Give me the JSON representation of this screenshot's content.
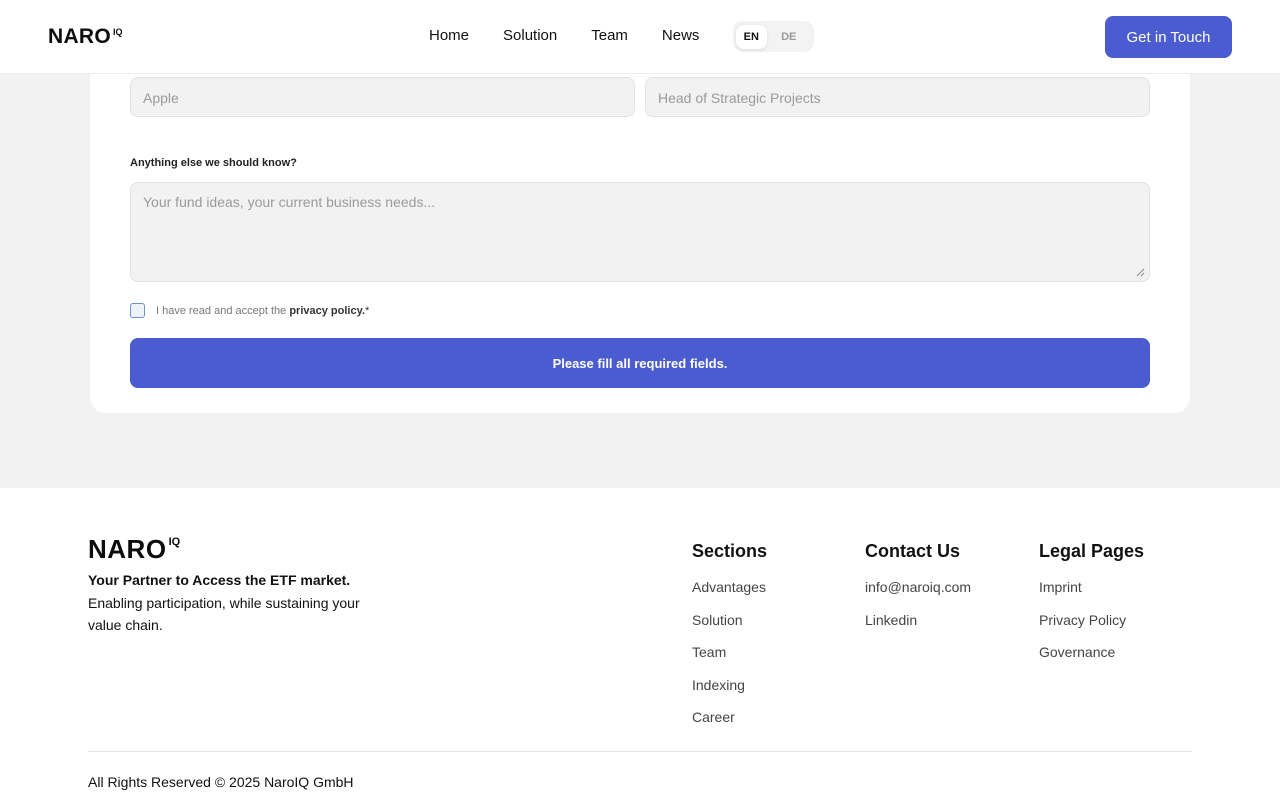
{
  "header": {
    "logo": "NARO",
    "logo_sup": "IQ",
    "nav": [
      "Home",
      "Solution",
      "Team",
      "News"
    ],
    "languages": [
      "EN",
      "DE"
    ],
    "active_language": "EN",
    "cta": "Get in Touch"
  },
  "form": {
    "company_placeholder": "Apple",
    "position_placeholder": "Head of Strategic Projects",
    "message_label": "Anything else we should know?",
    "message_placeholder": "Your fund ideas, your current business needs...",
    "privacy_prefix": "I have read and accept the ",
    "privacy_link": "privacy policy.",
    "required_mark": "*",
    "submit_label": "Please fill all required fields."
  },
  "footer": {
    "logo": "NARO",
    "logo_sup": "IQ",
    "tagline": "Your Partner to Access the ETF market.",
    "description": "Enabling participation, while sustaining your value chain.",
    "sections": {
      "title": "Sections",
      "links": [
        "Advantages",
        "Solution",
        "Team",
        "Indexing",
        "Career"
      ]
    },
    "contact": {
      "title": "Contact Us",
      "links": [
        "info@naroiq.com",
        "Linkedin"
      ]
    },
    "legal": {
      "title": "Legal Pages",
      "links": [
        "Imprint",
        "Privacy Policy",
        "Governance"
      ]
    },
    "copyright": "All Rights Reserved © 2025 NaroIQ GmbH"
  },
  "colors": {
    "accent": "#4a5ccf",
    "background": "#f2f2f2"
  }
}
